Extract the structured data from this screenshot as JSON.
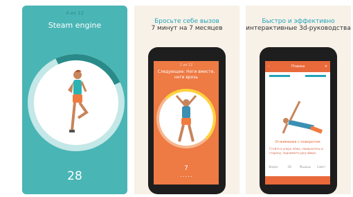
{
  "panel1": {
    "counter": "4 из 12",
    "title": "Steam engine",
    "value": "28"
  },
  "panel2": {
    "heading_line1": "Бросьте себе вызов",
    "heading_line2": "7 минут на 7 месяцев",
    "phone": {
      "counter": "1 из 12",
      "next_title": "Следующее: Ноги вместе, ноги врозь",
      "count": "7",
      "dots": "• • • • •"
    }
  },
  "panel3": {
    "heading_line1": "Быстро и эффективно",
    "heading_line2": "интерактивные 3d-руководства",
    "phone": {
      "screen_title": "Планка",
      "caption": "Отжимания с поворотом",
      "description": "Стойте в упоре лёжа, повернитесь в сторону, поднимите руку вверх.",
      "tab_labels": [
        "Видео",
        "3D",
        "Мышцы",
        "Совет"
      ]
    }
  },
  "colors": {
    "teal": "#4ab5b5",
    "orange": "#ee7a44",
    "accent": "#23a3b8",
    "cream": "#f7f1e8"
  }
}
